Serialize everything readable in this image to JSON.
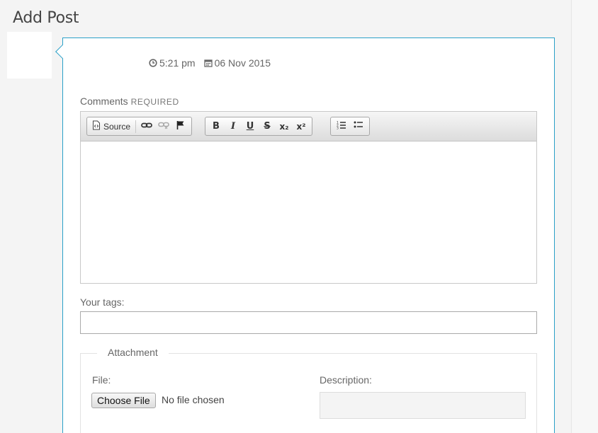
{
  "page": {
    "title": "Add Post"
  },
  "post": {
    "time": "5:21 pm",
    "date": "06 Nov 2015",
    "time_icon": "clock-icon",
    "date_icon": "calendar-icon"
  },
  "comments": {
    "label": "Comments",
    "required": "REQUIRED",
    "value": ""
  },
  "toolbar": {
    "source_label": "Source",
    "bold": "B",
    "italic": "I",
    "underline": "U",
    "strike": "S",
    "subscript": "x₂",
    "superscript": "x²",
    "icons": [
      "source-icon",
      "link-icon",
      "unlink-icon",
      "anchor-flag-icon",
      "bold-icon",
      "italic-icon",
      "underline-icon",
      "strikethrough-icon",
      "subscript-icon",
      "superscript-icon",
      "numbered-list-icon",
      "bulleted-list-icon"
    ]
  },
  "tags": {
    "label": "Your tags:",
    "value": ""
  },
  "attachment": {
    "legend": "Attachment",
    "file_label": "File:",
    "choose_button": "Choose File",
    "file_status": "No file chosen",
    "description_label": "Description:",
    "description_value": ""
  },
  "colors": {
    "accent_border": "#2aa0c8"
  }
}
